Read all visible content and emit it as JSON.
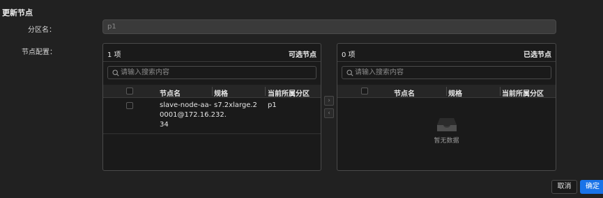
{
  "dialog": {
    "title": "更新节点"
  },
  "form": {
    "partition_label": "分区名：",
    "partition_value": "p1",
    "nodes_label": "节点配置："
  },
  "available": {
    "count": "1 项",
    "title": "可选节点",
    "search_placeholder": "请输入搜索内容",
    "columns": [
      "节点名",
      "规格",
      "当前所属分区"
    ],
    "rows": [
      {
        "name_lines": [
          "slave-node-aa-",
          "0001@172.16.232.",
          "34"
        ],
        "spec": "s7.2xlarge.2",
        "partition": "p1"
      }
    ]
  },
  "selected": {
    "count": "0 项",
    "title": "已选节点",
    "search_placeholder": "请输入搜索内容",
    "columns": [
      "节点名",
      "规格",
      "当前所属分区"
    ],
    "empty_text": "暂无数据"
  },
  "transfer": {
    "right_icon": "›",
    "left_icon": "‹"
  },
  "buttons": {
    "cancel": "取消",
    "ok": "确定"
  },
  "colors": {
    "background": "#212121",
    "panel": "#1a1a1a",
    "border": "#4a4a4a",
    "primary": "#1a73e8"
  }
}
